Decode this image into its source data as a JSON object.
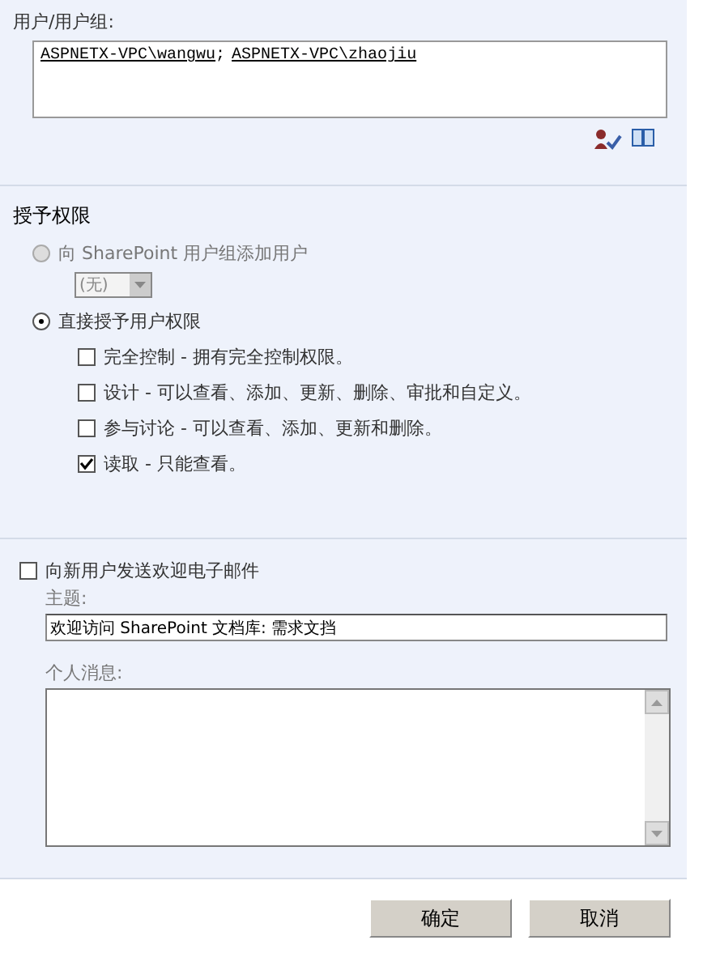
{
  "users": {
    "label": "用户/用户组:",
    "names": [
      "ASPNETX-VPC\\wangwu",
      "ASPNETX-VPC\\zhaojiu"
    ],
    "separator": ";"
  },
  "permissions": {
    "title": "授予权限",
    "options": [
      {
        "label": "向 SharePoint 用户组添加用户",
        "selected": false,
        "disabled": true,
        "dropdown": {
          "value": "(无)",
          "disabled": true
        }
      },
      {
        "label": "直接授予用户权限",
        "selected": true,
        "disabled": false
      }
    ],
    "levels": [
      {
        "label": "完全控制 - 拥有完全控制权限。",
        "checked": false
      },
      {
        "label": "设计 - 可以查看、添加、更新、删除、审批和自定义。",
        "checked": false
      },
      {
        "label": "参与讨论 - 可以查看、添加、更新和删除。",
        "checked": false
      },
      {
        "label": "读取 - 只能查看。",
        "checked": true
      }
    ]
  },
  "email": {
    "label": "向新用户发送欢迎电子邮件",
    "checked": false,
    "subject_label": "主题:",
    "subject": "欢迎访问 SharePoint 文档库: 需求文挡",
    "message_label": "个人消息:"
  },
  "buttons": [
    "确定",
    "取消"
  ]
}
